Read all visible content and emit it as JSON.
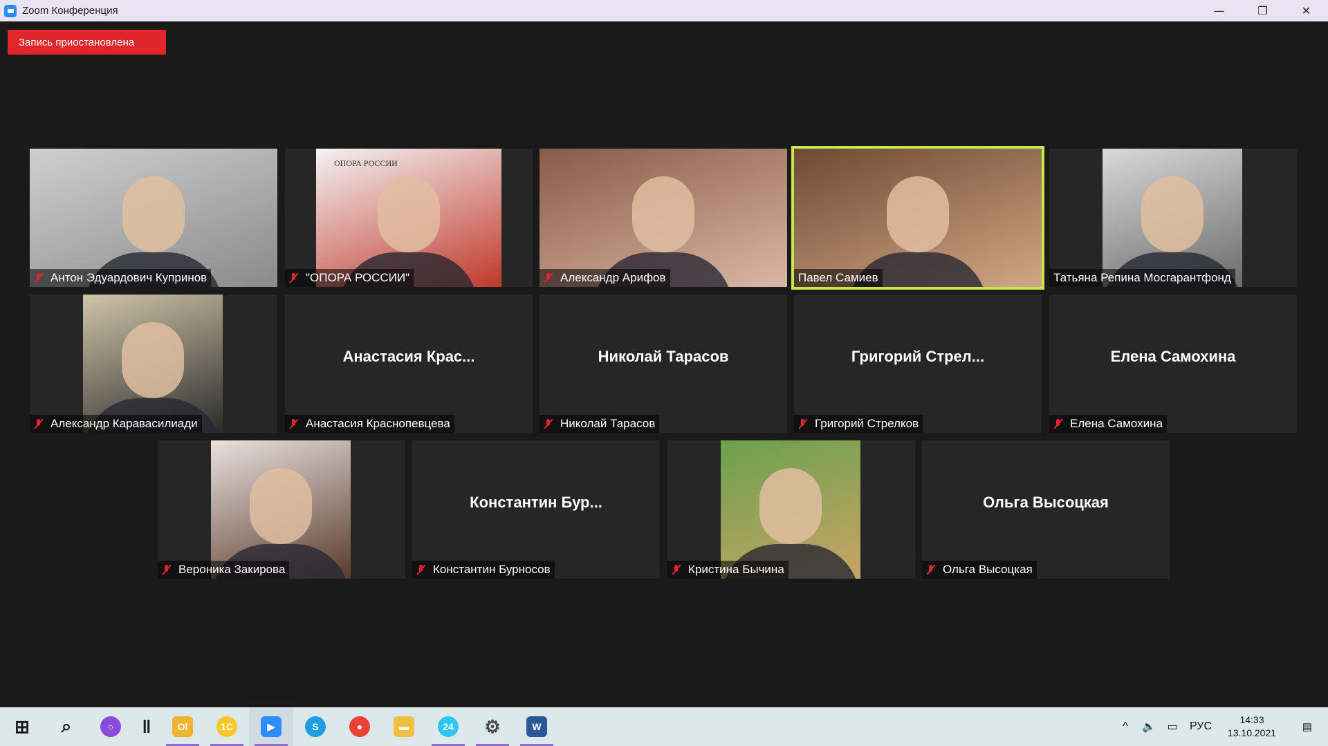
{
  "window": {
    "title": "Zoom Конференция",
    "minimize": "—",
    "restore": "❐",
    "close": "✕"
  },
  "recording_banner": "Запись приостановлена",
  "participants": [
    {
      "name": "Антон Эдуардович Купринов",
      "muted": true,
      "video": true,
      "colors": [
        "#cfcfcf",
        "#8a8a8a"
      ]
    },
    {
      "name": "\"ОПОРА РОССИИ\"",
      "muted": true,
      "video": true,
      "colors": [
        "#f3f3f3",
        "#c0392b"
      ],
      "logo_text": "ОПОРА РОССИИ"
    },
    {
      "name": "Александр Арифов",
      "muted": true,
      "video": true,
      "colors": [
        "#8a5a48",
        "#d9b8a5"
      ]
    },
    {
      "name": "Павел Самиев",
      "muted": false,
      "video": true,
      "active": true,
      "colors": [
        "#6e4a34",
        "#d0a784"
      ]
    },
    {
      "name": "Татьяна Репина Мосгарантфонд",
      "muted": false,
      "video": true,
      "colors": [
        "#d9d9d9",
        "#6b6b6b"
      ]
    },
    {
      "name": "Александр Каравасилиади",
      "muted": true,
      "video": true,
      "colors": [
        "#cfc5a8",
        "#2b2b2b"
      ]
    },
    {
      "name": "Анастасия Краснопевцева",
      "center_name": "Анастасия Крас...",
      "muted": true,
      "video": false
    },
    {
      "name": "Николай Тарасов",
      "center_name": "Николай Тарасов",
      "muted": true,
      "video": false
    },
    {
      "name": "Григорий Стрелков",
      "center_name": "Григорий Стрел...",
      "muted": true,
      "video": false
    },
    {
      "name": "Елена Самохина",
      "center_name": "Елена Самохина",
      "muted": true,
      "video": false
    },
    {
      "name": "Вероника Закирова",
      "muted": true,
      "video": true,
      "colors": [
        "#e8e2dc",
        "#5a3b2e"
      ]
    },
    {
      "name": "Константин Бурносов",
      "center_name": "Константин  Бур...",
      "muted": true,
      "video": false
    },
    {
      "name": "Кристина Бычина",
      "muted": true,
      "video": true,
      "colors": [
        "#6aa14a",
        "#c9a46a"
      ]
    },
    {
      "name": "Ольга Высоцкая",
      "center_name": "Ольга Высоцкая",
      "muted": true,
      "video": false
    }
  ],
  "taskbar": {
    "apps": [
      {
        "name": "start",
        "glyph": "⊞"
      },
      {
        "name": "search",
        "glyph": "⌕"
      },
      {
        "name": "alice",
        "glyph": "○"
      },
      {
        "name": "divider",
        "glyph": "‖"
      },
      {
        "name": "outlook",
        "glyph": "Ol"
      },
      {
        "name": "1c",
        "glyph": "1С"
      },
      {
        "name": "zoom",
        "glyph": "▶"
      },
      {
        "name": "skype",
        "glyph": "S"
      },
      {
        "name": "chrome",
        "glyph": "●"
      },
      {
        "name": "explorer",
        "glyph": "▬"
      },
      {
        "name": "bitrix24",
        "glyph": "24"
      },
      {
        "name": "settings",
        "glyph": "⚙"
      },
      {
        "name": "word",
        "glyph": "W"
      }
    ],
    "tray": {
      "chevron": "^",
      "volume": "🔈",
      "network": "▭",
      "language": "РУС",
      "time": "14:33",
      "date": "13.10.2021",
      "notifications": "▤"
    }
  }
}
